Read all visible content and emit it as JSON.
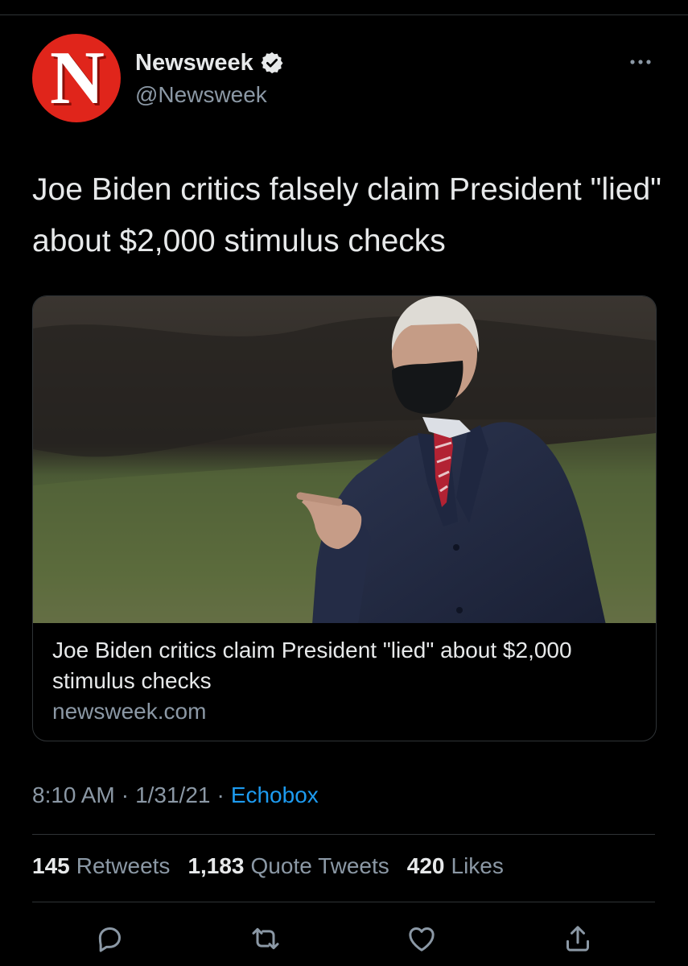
{
  "account": {
    "avatar_letter": "N",
    "avatar_color": "#e0251b",
    "display_name": "Newsweek",
    "verified": true,
    "handle": "@Newsweek"
  },
  "tweet": {
    "text": "Joe Biden critics falsely claim President \"lied\" about $2,000 stimulus checks"
  },
  "card": {
    "image_subject": "man in dark coat, red striped tie and black face mask pointing outdoors on grass",
    "title": "Joe Biden critics claim President \"lied\" about $2,000 stimulus checks",
    "domain": "newsweek.com"
  },
  "meta": {
    "time": "8:10 AM",
    "sep1": "·",
    "date": "1/31/21",
    "sep2": "·",
    "source": "Echobox"
  },
  "stats": {
    "retweets_count": "145",
    "retweets_label": "Retweets",
    "quotes_count": "1,183",
    "quotes_label": "Quote Tweets",
    "likes_count": "420",
    "likes_label": "Likes"
  },
  "actions": [
    "reply-icon",
    "retweet-icon",
    "like-icon",
    "share-icon"
  ],
  "colors": {
    "background": "#000000",
    "text": "#e7e9ea",
    "secondary": "#8b98a5",
    "link": "#1d9bf0",
    "border": "#2f3336"
  }
}
